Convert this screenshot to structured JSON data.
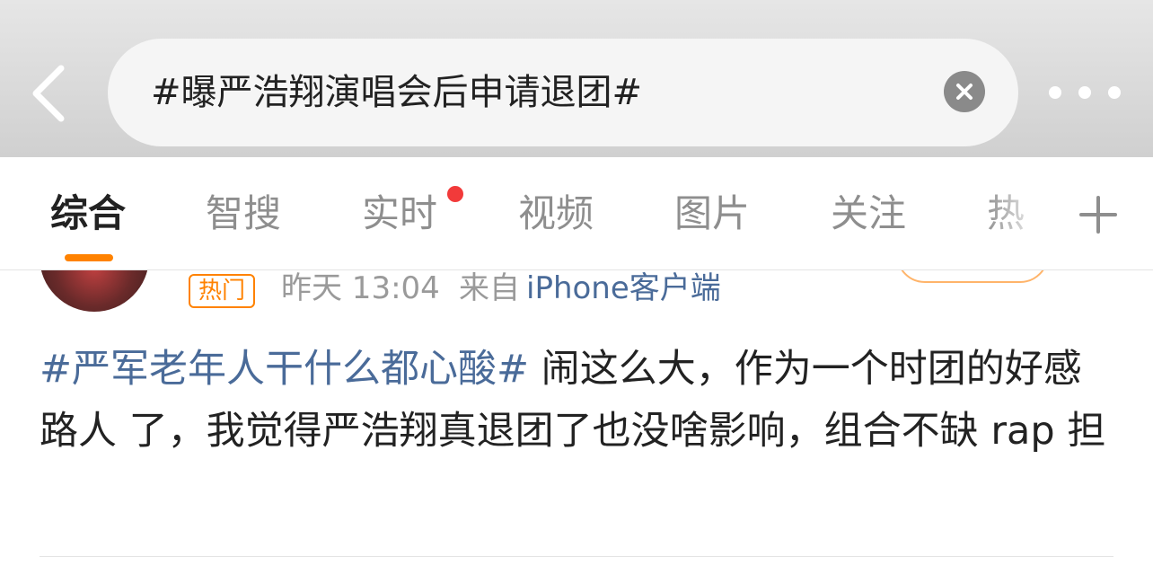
{
  "header": {
    "search_query": "#曝严浩翔演唱会后申请退团#",
    "back_icon": "chevron-left-icon",
    "clear_icon": "close-icon",
    "more_icon": "more-dots-icon"
  },
  "tabs": [
    {
      "label": "综合",
      "active": true
    },
    {
      "label": "智搜",
      "active": false
    },
    {
      "label": "实时",
      "active": false,
      "red_dot": true
    },
    {
      "label": "视频",
      "active": false
    },
    {
      "label": "图片",
      "active": false
    },
    {
      "label": "关注",
      "active": false
    },
    {
      "label": "热",
      "active": false
    }
  ],
  "tabs_add_icon": "plus-icon",
  "post": {
    "hot_badge": "热门",
    "time": "昨天 13:04",
    "from_label": "来自",
    "source": "iPhone客户端",
    "topic": "#严军老年人干什么都心酸#",
    "body": " 闹这么大，作为一个时团的好感路人 了，我觉得严浩翔真退团了也没啥影响，组合不缺 rap 担"
  },
  "colors": {
    "accent_orange": "#ff8200",
    "link_blue": "#4a6b99",
    "notification_red": "#f23a3a",
    "header_gray": "#dcdcdc"
  }
}
